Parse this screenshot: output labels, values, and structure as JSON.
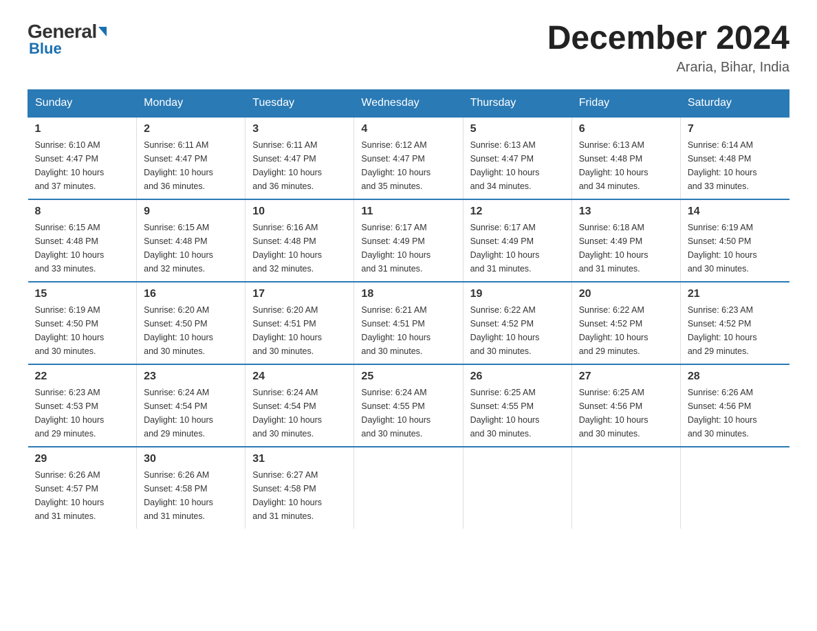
{
  "header": {
    "logo_general": "General",
    "logo_blue": "Blue",
    "month_year": "December 2024",
    "location": "Araria, Bihar, India"
  },
  "days_of_week": [
    "Sunday",
    "Monday",
    "Tuesday",
    "Wednesday",
    "Thursday",
    "Friday",
    "Saturday"
  ],
  "weeks": [
    [
      {
        "day": "1",
        "sunrise": "6:10 AM",
        "sunset": "4:47 PM",
        "daylight": "10 hours and 37 minutes."
      },
      {
        "day": "2",
        "sunrise": "6:11 AM",
        "sunset": "4:47 PM",
        "daylight": "10 hours and 36 minutes."
      },
      {
        "day": "3",
        "sunrise": "6:11 AM",
        "sunset": "4:47 PM",
        "daylight": "10 hours and 36 minutes."
      },
      {
        "day": "4",
        "sunrise": "6:12 AM",
        "sunset": "4:47 PM",
        "daylight": "10 hours and 35 minutes."
      },
      {
        "day": "5",
        "sunrise": "6:13 AM",
        "sunset": "4:47 PM",
        "daylight": "10 hours and 34 minutes."
      },
      {
        "day": "6",
        "sunrise": "6:13 AM",
        "sunset": "4:48 PM",
        "daylight": "10 hours and 34 minutes."
      },
      {
        "day": "7",
        "sunrise": "6:14 AM",
        "sunset": "4:48 PM",
        "daylight": "10 hours and 33 minutes."
      }
    ],
    [
      {
        "day": "8",
        "sunrise": "6:15 AM",
        "sunset": "4:48 PM",
        "daylight": "10 hours and 33 minutes."
      },
      {
        "day": "9",
        "sunrise": "6:15 AM",
        "sunset": "4:48 PM",
        "daylight": "10 hours and 32 minutes."
      },
      {
        "day": "10",
        "sunrise": "6:16 AM",
        "sunset": "4:48 PM",
        "daylight": "10 hours and 32 minutes."
      },
      {
        "day": "11",
        "sunrise": "6:17 AM",
        "sunset": "4:49 PM",
        "daylight": "10 hours and 31 minutes."
      },
      {
        "day": "12",
        "sunrise": "6:17 AM",
        "sunset": "4:49 PM",
        "daylight": "10 hours and 31 minutes."
      },
      {
        "day": "13",
        "sunrise": "6:18 AM",
        "sunset": "4:49 PM",
        "daylight": "10 hours and 31 minutes."
      },
      {
        "day": "14",
        "sunrise": "6:19 AM",
        "sunset": "4:50 PM",
        "daylight": "10 hours and 30 minutes."
      }
    ],
    [
      {
        "day": "15",
        "sunrise": "6:19 AM",
        "sunset": "4:50 PM",
        "daylight": "10 hours and 30 minutes."
      },
      {
        "day": "16",
        "sunrise": "6:20 AM",
        "sunset": "4:50 PM",
        "daylight": "10 hours and 30 minutes."
      },
      {
        "day": "17",
        "sunrise": "6:20 AM",
        "sunset": "4:51 PM",
        "daylight": "10 hours and 30 minutes."
      },
      {
        "day": "18",
        "sunrise": "6:21 AM",
        "sunset": "4:51 PM",
        "daylight": "10 hours and 30 minutes."
      },
      {
        "day": "19",
        "sunrise": "6:22 AM",
        "sunset": "4:52 PM",
        "daylight": "10 hours and 30 minutes."
      },
      {
        "day": "20",
        "sunrise": "6:22 AM",
        "sunset": "4:52 PM",
        "daylight": "10 hours and 29 minutes."
      },
      {
        "day": "21",
        "sunrise": "6:23 AM",
        "sunset": "4:52 PM",
        "daylight": "10 hours and 29 minutes."
      }
    ],
    [
      {
        "day": "22",
        "sunrise": "6:23 AM",
        "sunset": "4:53 PM",
        "daylight": "10 hours and 29 minutes."
      },
      {
        "day": "23",
        "sunrise": "6:24 AM",
        "sunset": "4:54 PM",
        "daylight": "10 hours and 29 minutes."
      },
      {
        "day": "24",
        "sunrise": "6:24 AM",
        "sunset": "4:54 PM",
        "daylight": "10 hours and 30 minutes."
      },
      {
        "day": "25",
        "sunrise": "6:24 AM",
        "sunset": "4:55 PM",
        "daylight": "10 hours and 30 minutes."
      },
      {
        "day": "26",
        "sunrise": "6:25 AM",
        "sunset": "4:55 PM",
        "daylight": "10 hours and 30 minutes."
      },
      {
        "day": "27",
        "sunrise": "6:25 AM",
        "sunset": "4:56 PM",
        "daylight": "10 hours and 30 minutes."
      },
      {
        "day": "28",
        "sunrise": "6:26 AM",
        "sunset": "4:56 PM",
        "daylight": "10 hours and 30 minutes."
      }
    ],
    [
      {
        "day": "29",
        "sunrise": "6:26 AM",
        "sunset": "4:57 PM",
        "daylight": "10 hours and 31 minutes."
      },
      {
        "day": "30",
        "sunrise": "6:26 AM",
        "sunset": "4:58 PM",
        "daylight": "10 hours and 31 minutes."
      },
      {
        "day": "31",
        "sunrise": "6:27 AM",
        "sunset": "4:58 PM",
        "daylight": "10 hours and 31 minutes."
      },
      null,
      null,
      null,
      null
    ]
  ],
  "labels": {
    "sunrise": "Sunrise:",
    "sunset": "Sunset:",
    "daylight": "Daylight:"
  }
}
